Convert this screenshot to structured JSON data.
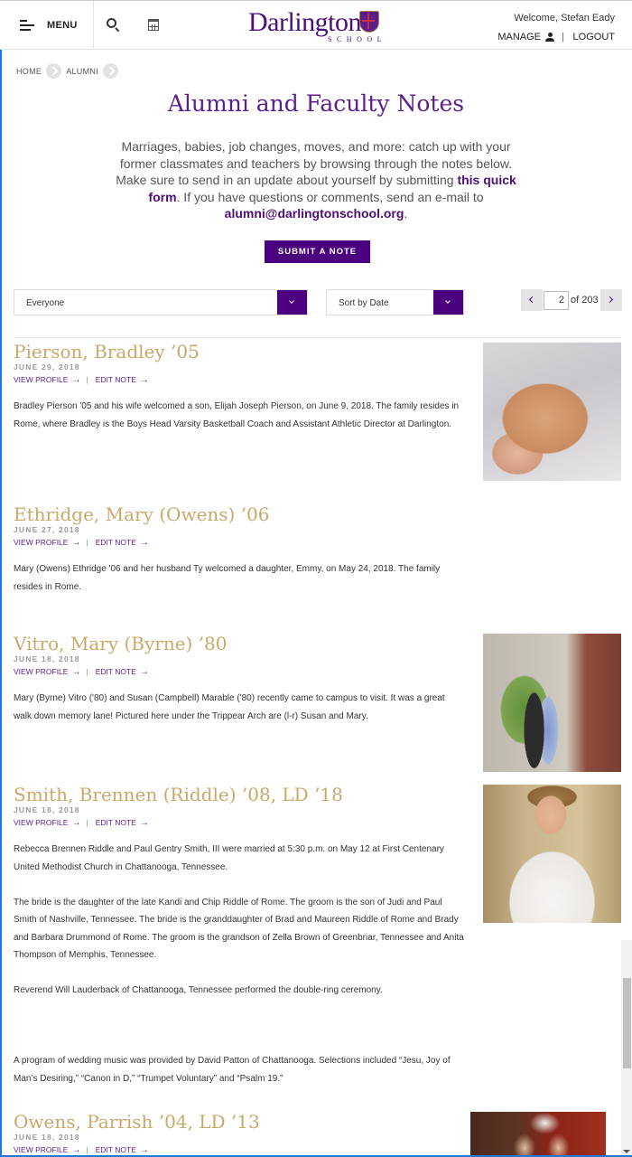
{
  "header": {
    "menu_label": "MENU",
    "logo_text": "Darlington",
    "logo_subtext": "SCHOOL",
    "welcome": "Welcome, Stefan Eady",
    "manage_label": "MANAGE",
    "separator": "|",
    "logout_label": "LOGOUT"
  },
  "breadcrumb": [
    {
      "label": "HOME"
    },
    {
      "label": "ALUMNI"
    }
  ],
  "page": {
    "title": "Alumni and Faculty Notes",
    "intro_1": "Marriages, babies, job changes, moves, and more: catch up with your former classmates and teachers by browsing through the notes below. Make sure to send in an update about yourself by submitting ",
    "intro_link": "this quick form",
    "intro_2": ". If you have questions or comments, send an e-mail to ",
    "intro_email": "alumni@darlingtonschool.org",
    "intro_3": ".",
    "submit_label": "SUBMIT A NOTE"
  },
  "filters": {
    "audience_value": "Everyone",
    "sort_value": "Sort by Date"
  },
  "pagination": {
    "current_page": "2",
    "of_label": "of 203"
  },
  "note_links": {
    "view_profile": "VIEW PROFILE",
    "edit_note": "EDIT NOTE",
    "arrow": "→",
    "separator": "|"
  },
  "notes": [
    {
      "name": "Pierson, Bradley ’05",
      "date": "JUNE 29, 2018",
      "body": [
        "Bradley Pierson '05 and his wife welcomed a son, Elijah Joseph Pierson, on June 9, 2018.  The family resides in Rome, where Bradley is the Boys Head Varsity Basketball Coach and Assistant Athletic Director at Darlington."
      ],
      "photo": "newborn baby sleeping"
    },
    {
      "name": "Ethridge, Mary (Owens) ’06",
      "date": "JUNE 27, 2018",
      "body": [
        "Mary (Owens) Ethridge '06 and her husband Ty welcomed a daughter, Emmy, on May 24, 2018.  The family resides in Rome."
      ]
    },
    {
      "name": "Vitro, Mary (Byrne) ’80",
      "date": "JUNE 18, 2018",
      "body": [
        "Mary (Byrne) Vitro ('80) and Susan (Campbell) Marable ('80) recently came to campus to visit.  It was a great walk down memory lane!  Pictured here under the Trippear Arch are (l-r) Susan and Mary."
      ],
      "photo": "two women under stone arch"
    },
    {
      "name": "Smith, Brennen (Riddle) ’08, LD ’18",
      "date": "JUNE 18, 2018",
      "body": [
        "Rebecca Brennen Riddle and Paul Gentry Smith, III were married at 5:30 p.m. on May 12 at First Centenary United Methodist Church in Chattanooga, Tennessee.",
        "The bride is the daughter of the late Kandi and Chip Riddle of Rome. The groom is the son of Judi and Paul Smith of Nashville, Tennessee. The bride is the granddaughter of Brad and Maureen Riddle of Rome and Brady and Barbara Drummond of Rome. The groom is the grandson of Zella Brown of Greenbriar, Tennessee and Anita Thompson of Memphis, Tennessee.",
        "Reverend Will Lauderback of Chattanooga, Tennessee performed the double-ring ceremony.",
        "",
        "A program of wedding music was provided by David Patton of Chattanooga. Selections included “Jesu, Joy of Man’s Desiring,” “Canon in D,” “Trumpet Voluntary” and “Psalm 19.”"
      ],
      "photo": "bride in wedding dress"
    },
    {
      "name": "Owens, Parrish ’04, LD ’13",
      "date": "JUNE 18, 2018",
      "body": [],
      "photo": "wedding couple"
    }
  ],
  "colors": {
    "brand_purple": "#4b0080",
    "title_purple": "#5b1f8e",
    "name_gold": "#c9a96a"
  }
}
